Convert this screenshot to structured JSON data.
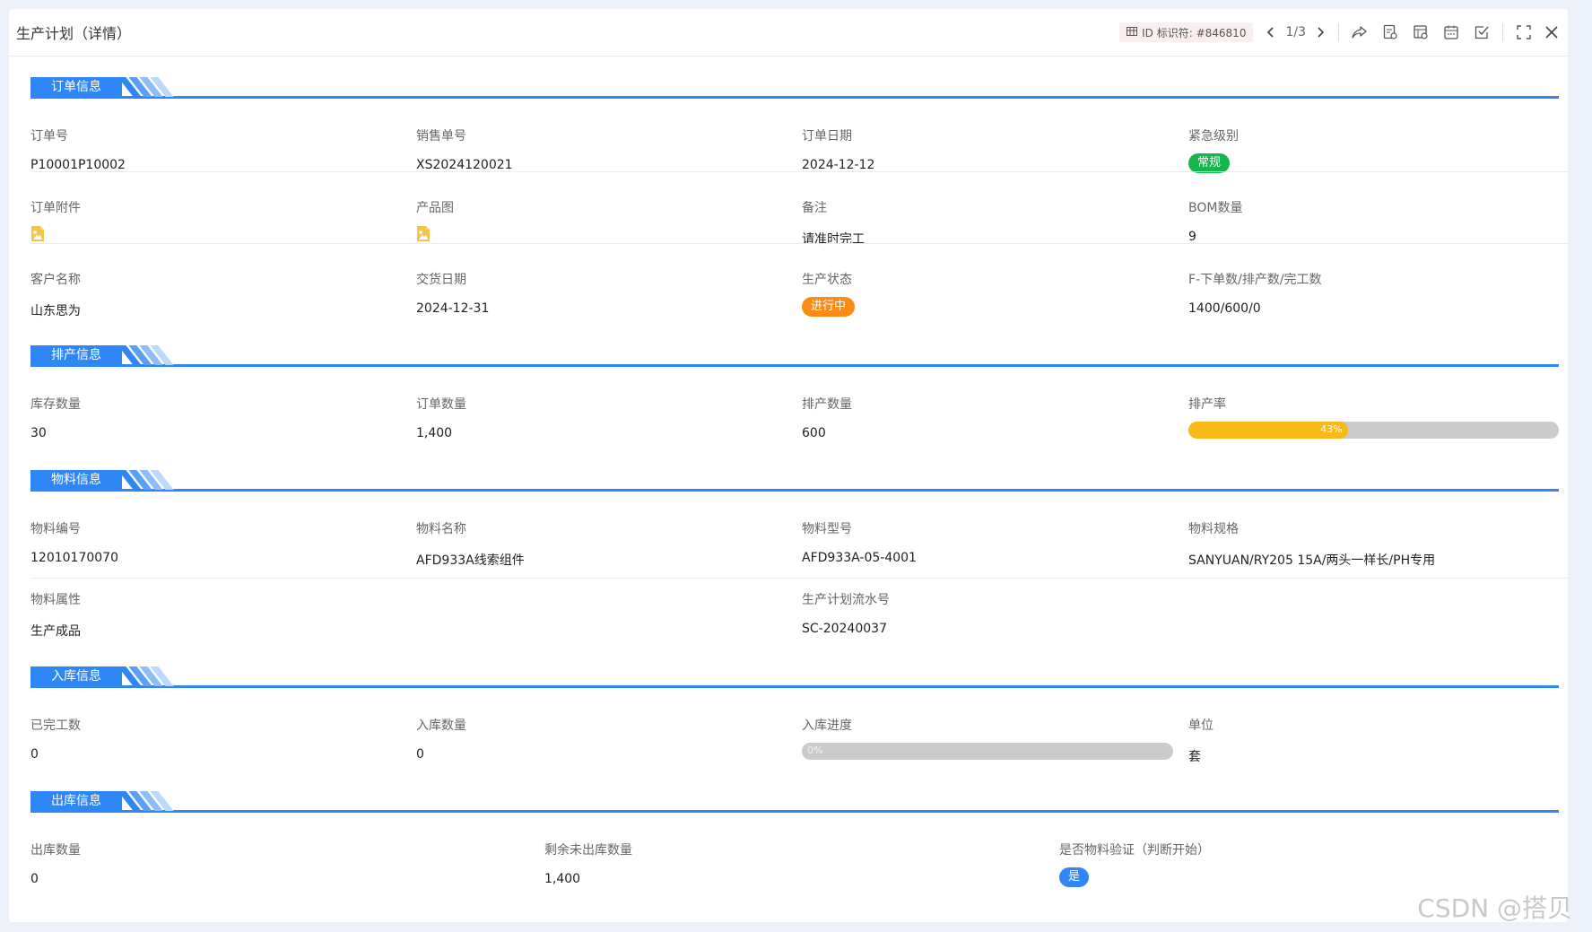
{
  "app": {
    "title": "生产计划（详情）",
    "record_id": "ID 标识符: #846810",
    "pager": "1/3"
  },
  "toolbar_icons": [
    "share-icon",
    "report-icon",
    "print-icon",
    "calendar-icon",
    "approve-icon",
    "fullscreen-icon",
    "close-icon"
  ],
  "colors": {
    "accent": "#2f86f5",
    "tag_normal": "#13b74b",
    "tag_inprogress": "#fa8c16",
    "progress_fill": "#fbb917",
    "progress_track": "#cbcbcb",
    "tag_yes": "#2f86f5"
  },
  "sections": {
    "order": {
      "title": "订单信息",
      "order_no": {
        "label": "订单号",
        "value": "P10001P10002"
      },
      "sales_no": {
        "label": "销售单号",
        "value": "XS2024120021"
      },
      "order_date": {
        "label": "订单日期",
        "value": "2024-12-12"
      },
      "urgency": {
        "label": "紧急级别",
        "value": "常规"
      },
      "attachment": {
        "label": "订单附件",
        "icon": "image-file-icon"
      },
      "product_image": {
        "label": "产品图",
        "icon": "image-file-icon"
      },
      "remark": {
        "label": "备注",
        "value": "请准时完工"
      },
      "bom_count": {
        "label": "BOM数量",
        "value": "9"
      },
      "customer": {
        "label": "客户名称",
        "value": "山东思为"
      },
      "delivery_date": {
        "label": "交货日期",
        "value": "2024-12-31"
      },
      "prod_status": {
        "label": "生产状态",
        "value": "进行中"
      },
      "counts": {
        "label": "F-下单数/排产数/完工数",
        "value": "1400/600/0"
      }
    },
    "schedule": {
      "title": "排产信息",
      "stock_qty": {
        "label": "库存数量",
        "value": "30"
      },
      "order_qty": {
        "label": "订单数量",
        "value": "1,400"
      },
      "sched_qty": {
        "label": "排产数量",
        "value": "600"
      },
      "sched_rate": {
        "label": "排产率",
        "value": 43,
        "text": "43%"
      }
    },
    "material": {
      "title": "物料信息",
      "code": {
        "label": "物料编号",
        "value": "12010170070"
      },
      "name": {
        "label": "物料名称",
        "value": "AFD933A线索组件"
      },
      "model": {
        "label": "物料型号",
        "value": "AFD933A-05-4001"
      },
      "spec": {
        "label": "物料规格",
        "value": "SANYUAN/RY205 15A/两头一样长/PH专用"
      },
      "attr": {
        "label": "物料属性",
        "value": "生产成品"
      },
      "serial": {
        "label": "生产计划流水号",
        "value": "SC-20240037"
      }
    },
    "inbound": {
      "title": "入库信息",
      "done_qty": {
        "label": "已完工数",
        "value": "0"
      },
      "in_qty": {
        "label": "入库数量",
        "value": "0"
      },
      "progress": {
        "label": "入库进度",
        "value": 0,
        "text": "0%"
      },
      "unit": {
        "label": "单位",
        "value": "套"
      }
    },
    "outbound": {
      "title": "出库信息",
      "out_qty": {
        "label": "出库数量",
        "value": "0"
      },
      "remaining": {
        "label": "剩余未出库数量",
        "value": "1,400"
      },
      "verify": {
        "label": "是否物料验证（判断开始）",
        "value": "是"
      }
    }
  },
  "watermark": "CSDN @搭贝"
}
